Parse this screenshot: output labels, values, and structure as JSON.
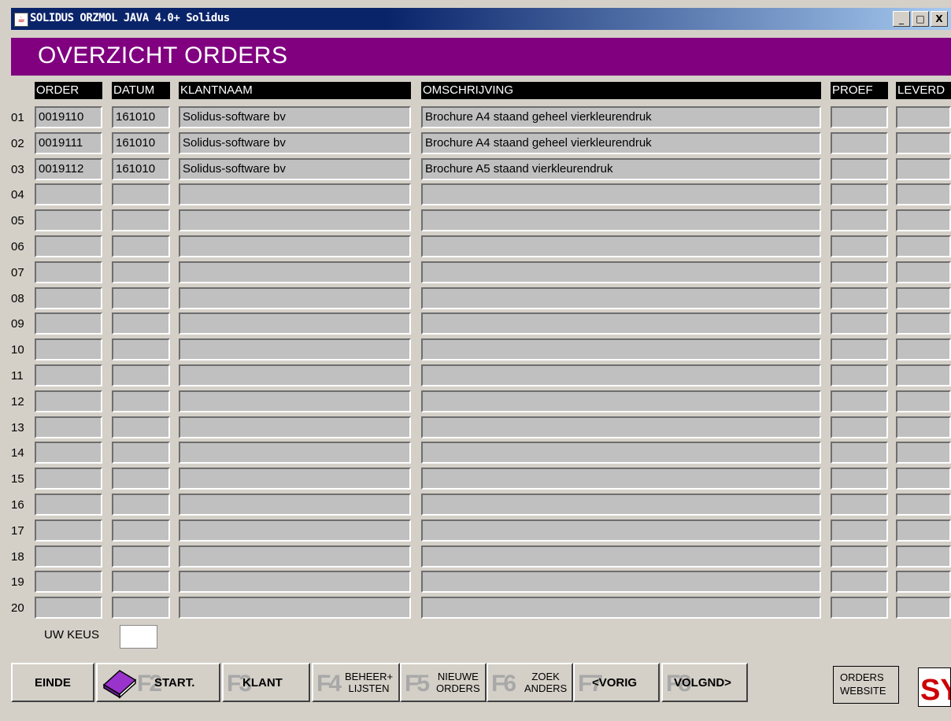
{
  "window": {
    "title": "SOLIDUS ORZMOL JAVA 4.0+ Solidus",
    "min_glyph": "_",
    "max_glyph": "□",
    "close_glyph": "X"
  },
  "header": {
    "title": "OVERZICHT ORDERS"
  },
  "columns": [
    "ORDER",
    "DATUM",
    "KLANTNAAM",
    "OMSCHRIJVING",
    "PROEF",
    "LEVERD"
  ],
  "rows": [
    {
      "num": "01",
      "order": "0019110",
      "datum": "161010",
      "klant": "Solidus-software bv",
      "omschrijving": "Brochure A4 staand geheel vierkleurendruk",
      "proef": "",
      "leverd": ""
    },
    {
      "num": "02",
      "order": "0019111",
      "datum": "161010",
      "klant": "Solidus-software bv",
      "omschrijving": "Brochure A4 staand geheel vierkleurendruk",
      "proef": "",
      "leverd": ""
    },
    {
      "num": "03",
      "order": "0019112",
      "datum": "161010",
      "klant": "Solidus-software bv",
      "omschrijving": "Brochure A5 staand vierkleurendruk",
      "proef": "",
      "leverd": ""
    },
    {
      "num": "04",
      "order": "",
      "datum": "",
      "klant": "",
      "omschrijving": "",
      "proef": "",
      "leverd": ""
    },
    {
      "num": "05",
      "order": "",
      "datum": "",
      "klant": "",
      "omschrijving": "",
      "proef": "",
      "leverd": ""
    },
    {
      "num": "06",
      "order": "",
      "datum": "",
      "klant": "",
      "omschrijving": "",
      "proef": "",
      "leverd": ""
    },
    {
      "num": "07",
      "order": "",
      "datum": "",
      "klant": "",
      "omschrijving": "",
      "proef": "",
      "leverd": ""
    },
    {
      "num": "08",
      "order": "",
      "datum": "",
      "klant": "",
      "omschrijving": "",
      "proef": "",
      "leverd": ""
    },
    {
      "num": "09",
      "order": "",
      "datum": "",
      "klant": "",
      "omschrijving": "",
      "proef": "",
      "leverd": ""
    },
    {
      "num": "10",
      "order": "",
      "datum": "",
      "klant": "",
      "omschrijving": "",
      "proef": "",
      "leverd": ""
    },
    {
      "num": "11",
      "order": "",
      "datum": "",
      "klant": "",
      "omschrijving": "",
      "proef": "",
      "leverd": ""
    },
    {
      "num": "12",
      "order": "",
      "datum": "",
      "klant": "",
      "omschrijving": "",
      "proef": "",
      "leverd": ""
    },
    {
      "num": "13",
      "order": "",
      "datum": "",
      "klant": "",
      "omschrijving": "",
      "proef": "",
      "leverd": ""
    },
    {
      "num": "14",
      "order": "",
      "datum": "",
      "klant": "",
      "omschrijving": "",
      "proef": "",
      "leverd": ""
    },
    {
      "num": "15",
      "order": "",
      "datum": "",
      "klant": "",
      "omschrijving": "",
      "proef": "",
      "leverd": ""
    },
    {
      "num": "16",
      "order": "",
      "datum": "",
      "klant": "",
      "omschrijving": "",
      "proef": "",
      "leverd": ""
    },
    {
      "num": "17",
      "order": "",
      "datum": "",
      "klant": "",
      "omschrijving": "",
      "proef": "",
      "leverd": ""
    },
    {
      "num": "18",
      "order": "",
      "datum": "",
      "klant": "",
      "omschrijving": "",
      "proef": "",
      "leverd": ""
    },
    {
      "num": "19",
      "order": "",
      "datum": "",
      "klant": "",
      "omschrijving": "",
      "proef": "",
      "leverd": ""
    },
    {
      "num": "20",
      "order": "",
      "datum": "",
      "klant": "",
      "omschrijving": "",
      "proef": "",
      "leverd": ""
    }
  ],
  "choice": {
    "label": "UW KEUS",
    "value": ""
  },
  "buttons": {
    "einde": "EINDE",
    "start": {
      "fkey": "F2",
      "label": "START."
    },
    "klant": {
      "fkey": "F3",
      "label": "KLANT"
    },
    "beheer": {
      "fkey": "F4",
      "line1": "BEHEER+",
      "line2": "LIJSTEN"
    },
    "nieuwe": {
      "fkey": "F5",
      "line1": "NIEUWE",
      "line2": "ORDERS"
    },
    "zoek": {
      "fkey": "F6",
      "line1": "ZOEK",
      "line2": "ANDERS"
    },
    "vorig": {
      "fkey": "F7",
      "label": "<VORIG"
    },
    "volgnd": {
      "fkey": "F8",
      "label": "VOLGND>"
    },
    "orders_website": {
      "line1": "ORDERS",
      "line2": "WEBSITE"
    }
  },
  "logo": {
    "text": "SY"
  },
  "colors": {
    "header_band": "#800080",
    "titlebar": "#0a246a",
    "cell": "#c0c0c0",
    "window_bg": "#d4d0c8"
  }
}
